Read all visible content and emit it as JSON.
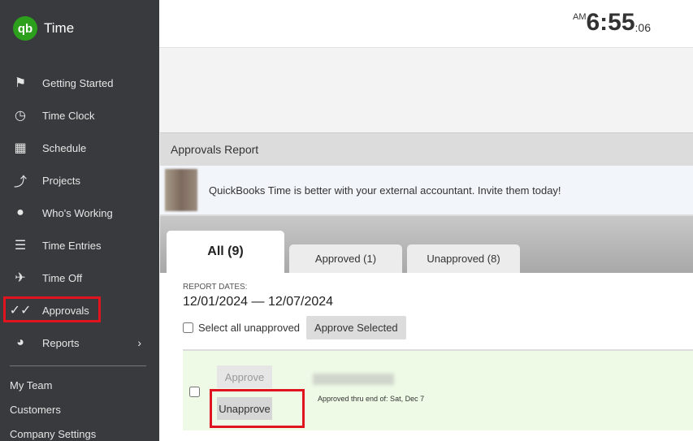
{
  "app": {
    "name": "Time",
    "logo": "qb"
  },
  "sidebar": {
    "items": [
      {
        "label": "Getting Started",
        "icon": "flag-icon"
      },
      {
        "label": "Time Clock",
        "icon": "clock-icon"
      },
      {
        "label": "Schedule",
        "icon": "calendar-icon"
      },
      {
        "label": "Projects",
        "icon": "trend-icon"
      },
      {
        "label": "Who's Working",
        "icon": "location-pin-icon"
      },
      {
        "label": "Time Entries",
        "icon": "list-clock-icon"
      },
      {
        "label": "Time Off",
        "icon": "airplane-icon"
      },
      {
        "label": "Approvals",
        "icon": "double-check-icon"
      },
      {
        "label": "Reports",
        "icon": "pie-chart-icon"
      }
    ],
    "sub": [
      "My Team",
      "Customers",
      "Company Settings"
    ]
  },
  "clock": {
    "ampm": "AM",
    "hm": "6:55",
    "sec": ":06"
  },
  "panel": {
    "title": "Approvals Report",
    "banner": "QuickBooks Time is better with your external accountant. Invite them today!",
    "tabs": [
      "All (9)",
      "Approved (1)",
      "Unapproved (8)"
    ],
    "report_dates_label": "REPORT DATES:",
    "report_dates": "12/01/2024 — 12/07/2024",
    "select_all": "Select all unapproved",
    "approve_selected": "Approve Selected",
    "row": {
      "approve": "Approve",
      "unapprove": "Unapprove",
      "note": "Approved thru end of: Sat, Dec 7"
    }
  }
}
